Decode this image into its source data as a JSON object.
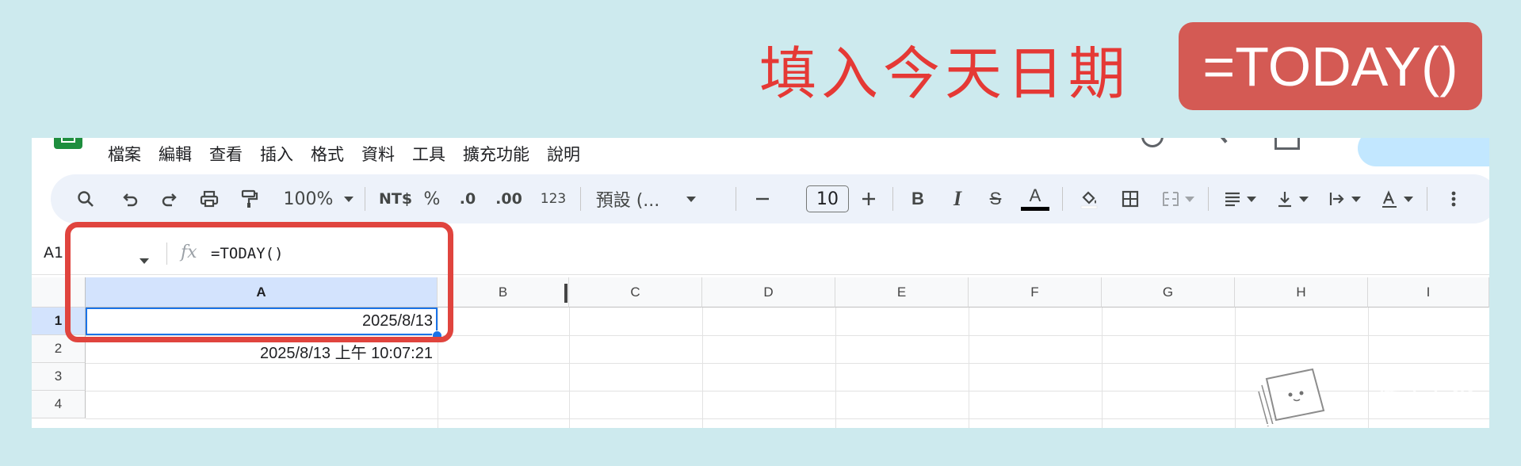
{
  "annotation": {
    "headline": "填入今天日期",
    "formula_badge": "=TODAY()"
  },
  "menubar": {
    "items": [
      "檔案",
      "編輯",
      "查看",
      "插入",
      "格式",
      "資料",
      "工具",
      "擴充功能",
      "說明"
    ]
  },
  "toolbar": {
    "zoom": "100%",
    "currency": "NT$",
    "percent": "%",
    "decrease_decimal": ".0",
    "increase_decimal": ".00",
    "number_format": "123",
    "font_name": "預設 (...",
    "font_size": "10",
    "bold": "B",
    "italic": "I",
    "strikethrough": "S",
    "text_color": "A"
  },
  "formula_bar": {
    "cell_ref": "A1",
    "fx": "fx",
    "value": "=TODAY()"
  },
  "grid": {
    "columns": [
      "A",
      "B",
      "C",
      "D",
      "E",
      "F",
      "G",
      "H",
      "I"
    ],
    "rows": [
      "1",
      "2",
      "3",
      "4"
    ],
    "cells": {
      "A1": "2025/8/13",
      "A2": "2025/8/13 上午 10:07:21"
    },
    "selected_cell": "A1"
  },
  "watermark": {
    "title": "淺口袋",
    "subtitle": "Money Pocket"
  },
  "colors": {
    "background": "#cdeaee",
    "annotation_red": "#e53935",
    "badge": "#d45a54",
    "selection_blue": "#1a73e8",
    "toolbar_bg": "#edf2fa"
  }
}
